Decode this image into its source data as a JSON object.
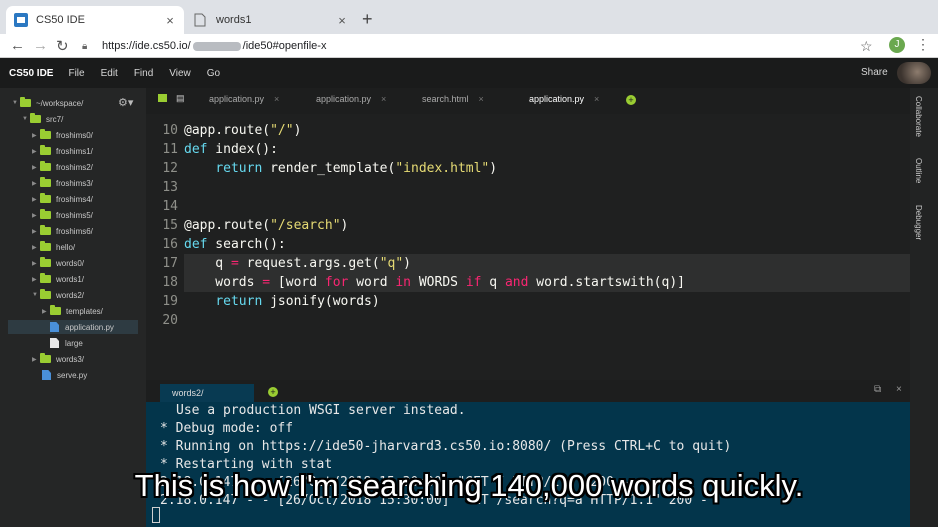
{
  "browser": {
    "tabs": [
      {
        "title": "CS50 IDE",
        "close": "×"
      },
      {
        "title": "words1",
        "close": "×"
      }
    ],
    "new_tab": "+",
    "url_prefix": "https://ide.cs50.io/",
    "url_suffix": "/ide50#openfile-x",
    "profile_initial": "J"
  },
  "menubar": {
    "brand": "CS50 IDE",
    "items": [
      "File",
      "Edit",
      "Find",
      "View",
      "Go"
    ],
    "share": "Share"
  },
  "sidebar": {
    "items": [
      {
        "label": "~/workspace/",
        "kind": "folder",
        "open": true
      },
      {
        "label": "src7/",
        "kind": "folder",
        "open": true
      },
      {
        "label": "froshims0/",
        "kind": "folder"
      },
      {
        "label": "froshims1/",
        "kind": "folder"
      },
      {
        "label": "froshims2/",
        "kind": "folder"
      },
      {
        "label": "froshims3/",
        "kind": "folder"
      },
      {
        "label": "froshims4/",
        "kind": "folder"
      },
      {
        "label": "froshims5/",
        "kind": "folder"
      },
      {
        "label": "froshims6/",
        "kind": "folder"
      },
      {
        "label": "hello/",
        "kind": "folder"
      },
      {
        "label": "words0/",
        "kind": "folder"
      },
      {
        "label": "words1/",
        "kind": "folder"
      },
      {
        "label": "words2/",
        "kind": "folder",
        "open": true
      },
      {
        "label": "templates/",
        "kind": "folder"
      },
      {
        "label": "application.py",
        "kind": "py",
        "selected": true
      },
      {
        "label": "large",
        "kind": "file"
      },
      {
        "label": "words3/",
        "kind": "folder"
      },
      {
        "label": "serve.py",
        "kind": "py"
      }
    ]
  },
  "editor_tabs": [
    {
      "label": "application.py",
      "close": "×"
    },
    {
      "label": "application.py",
      "close": "×"
    },
    {
      "label": "search.html",
      "close": "×"
    },
    {
      "label": "application.py",
      "close": "×",
      "active": true
    }
  ],
  "code": {
    "line_numbers": [
      "10",
      "11",
      "12",
      "13",
      "14",
      "15",
      "16",
      "17",
      "18",
      "19",
      "20"
    ]
  },
  "right_panel": [
    "Collaborate",
    "Outline",
    "Debugger"
  ],
  "terminal": {
    "tab_label": "words2/",
    "tab_close": "×",
    "lines": [
      "Use a production WSGI server instead.",
      "* Debug mode: off",
      "* Running on https://ide50-jharvard3.cs50.io:8080/ (Press CTRL+C to quit)",
      "* Restarting with stat",
      "2.18.0.147 - - [26/Oct/2018 15:30:00] \"GET / HTTP/1.1\" 200 -",
      "2.18.0.147 - - [26/Oct/2018 15:30:00] \"GET /search?q=a HTTP/1.1\" 200 -"
    ]
  },
  "caption": "This is how I'm searching 140,000 words quickly."
}
